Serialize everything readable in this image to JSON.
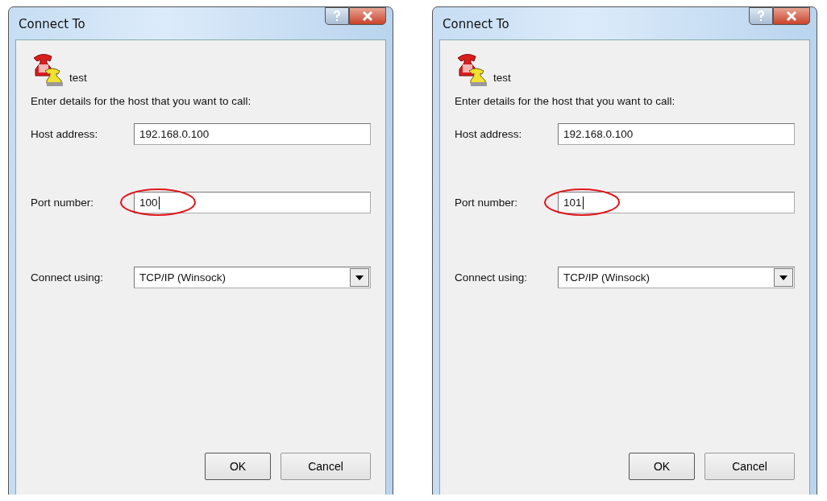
{
  "dialogs": [
    {
      "title": "Connect To",
      "name": "test",
      "prompt": "Enter details for the host that you want to call:",
      "host": {
        "label": "Host address:",
        "value": "192.168.0.100"
      },
      "port": {
        "label": "Port number:",
        "value": "100",
        "focused": true,
        "circled": true
      },
      "connect": {
        "label": "Connect using:",
        "value": "TCP/IP (Winsock)"
      },
      "buttons": [
        "OK",
        "Cancel"
      ]
    },
    {
      "title": "Connect To",
      "name": "test",
      "prompt": "Enter details for the host that you want to call:",
      "host": {
        "label": "Host address:",
        "value": "192.168.0.100"
      },
      "port": {
        "label": "Port number:",
        "value": "101",
        "focused": true,
        "circled": true
      },
      "connect": {
        "label": "Connect using:",
        "value": "TCP/IP (Winsock)"
      },
      "buttons": [
        "OK",
        "Cancel"
      ]
    }
  ]
}
